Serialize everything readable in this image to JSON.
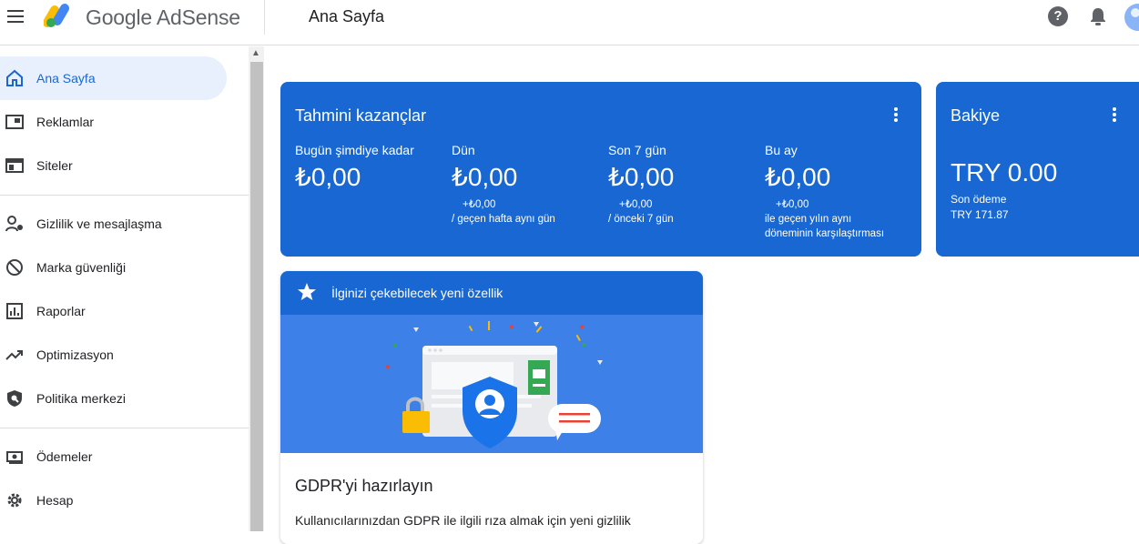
{
  "header": {
    "brand": "Google AdSense",
    "page_title": "Ana Sayfa",
    "help_icon": "help-icon",
    "notifications_icon": "bell-icon"
  },
  "sidebar": {
    "items": [
      {
        "label": "Ana Sayfa",
        "icon": "home-icon",
        "active": true
      },
      {
        "label": "Reklamlar",
        "icon": "ads-icon"
      },
      {
        "label": "Siteler",
        "icon": "sites-icon"
      },
      {
        "label": "Gizlilik ve mesajlaşma",
        "icon": "privacy-icon"
      },
      {
        "label": "Marka güvenliği",
        "icon": "block-icon"
      },
      {
        "label": "Raporlar",
        "icon": "reports-icon"
      },
      {
        "label": "Optimizasyon",
        "icon": "trending-icon"
      },
      {
        "label": "Politika merkezi",
        "icon": "policy-icon"
      },
      {
        "label": "Ödemeler",
        "icon": "payments-icon"
      },
      {
        "label": "Hesap",
        "icon": "gear-icon"
      }
    ]
  },
  "earnings": {
    "title": "Tahmini kazançlar",
    "metrics": [
      {
        "label": "Bugün şimdiye kadar",
        "value": "₺0,00",
        "change": "",
        "note": ""
      },
      {
        "label": "Dün",
        "value": "₺0,00",
        "change": "+₺0,00",
        "note": "/ geçen hafta aynı gün"
      },
      {
        "label": "Son 7 gün",
        "value": "₺0,00",
        "change": "+₺0,00",
        "note": "/ önceki 7 gün"
      },
      {
        "label": "Bu ay",
        "value": "₺0,00",
        "change": "+₺0,00",
        "note": "ile geçen yılın aynı",
        "note2": "döneminin karşılaştırması"
      }
    ]
  },
  "balance": {
    "title": "Bakiye",
    "value": "TRY 0.00",
    "last_payment_label": "Son ödeme",
    "last_payment_value": "TRY 171.87"
  },
  "feature": {
    "header": "İlginizi çekebilecek yeni özellik",
    "title": "GDPR'yi hazırlayın",
    "body": "Kullanıcılarınızdan GDPR ile ilgili rıza almak için yeni gizlilik"
  },
  "colors": {
    "accent": "#1967d2",
    "active_nav_bg": "#e8f0fe"
  }
}
